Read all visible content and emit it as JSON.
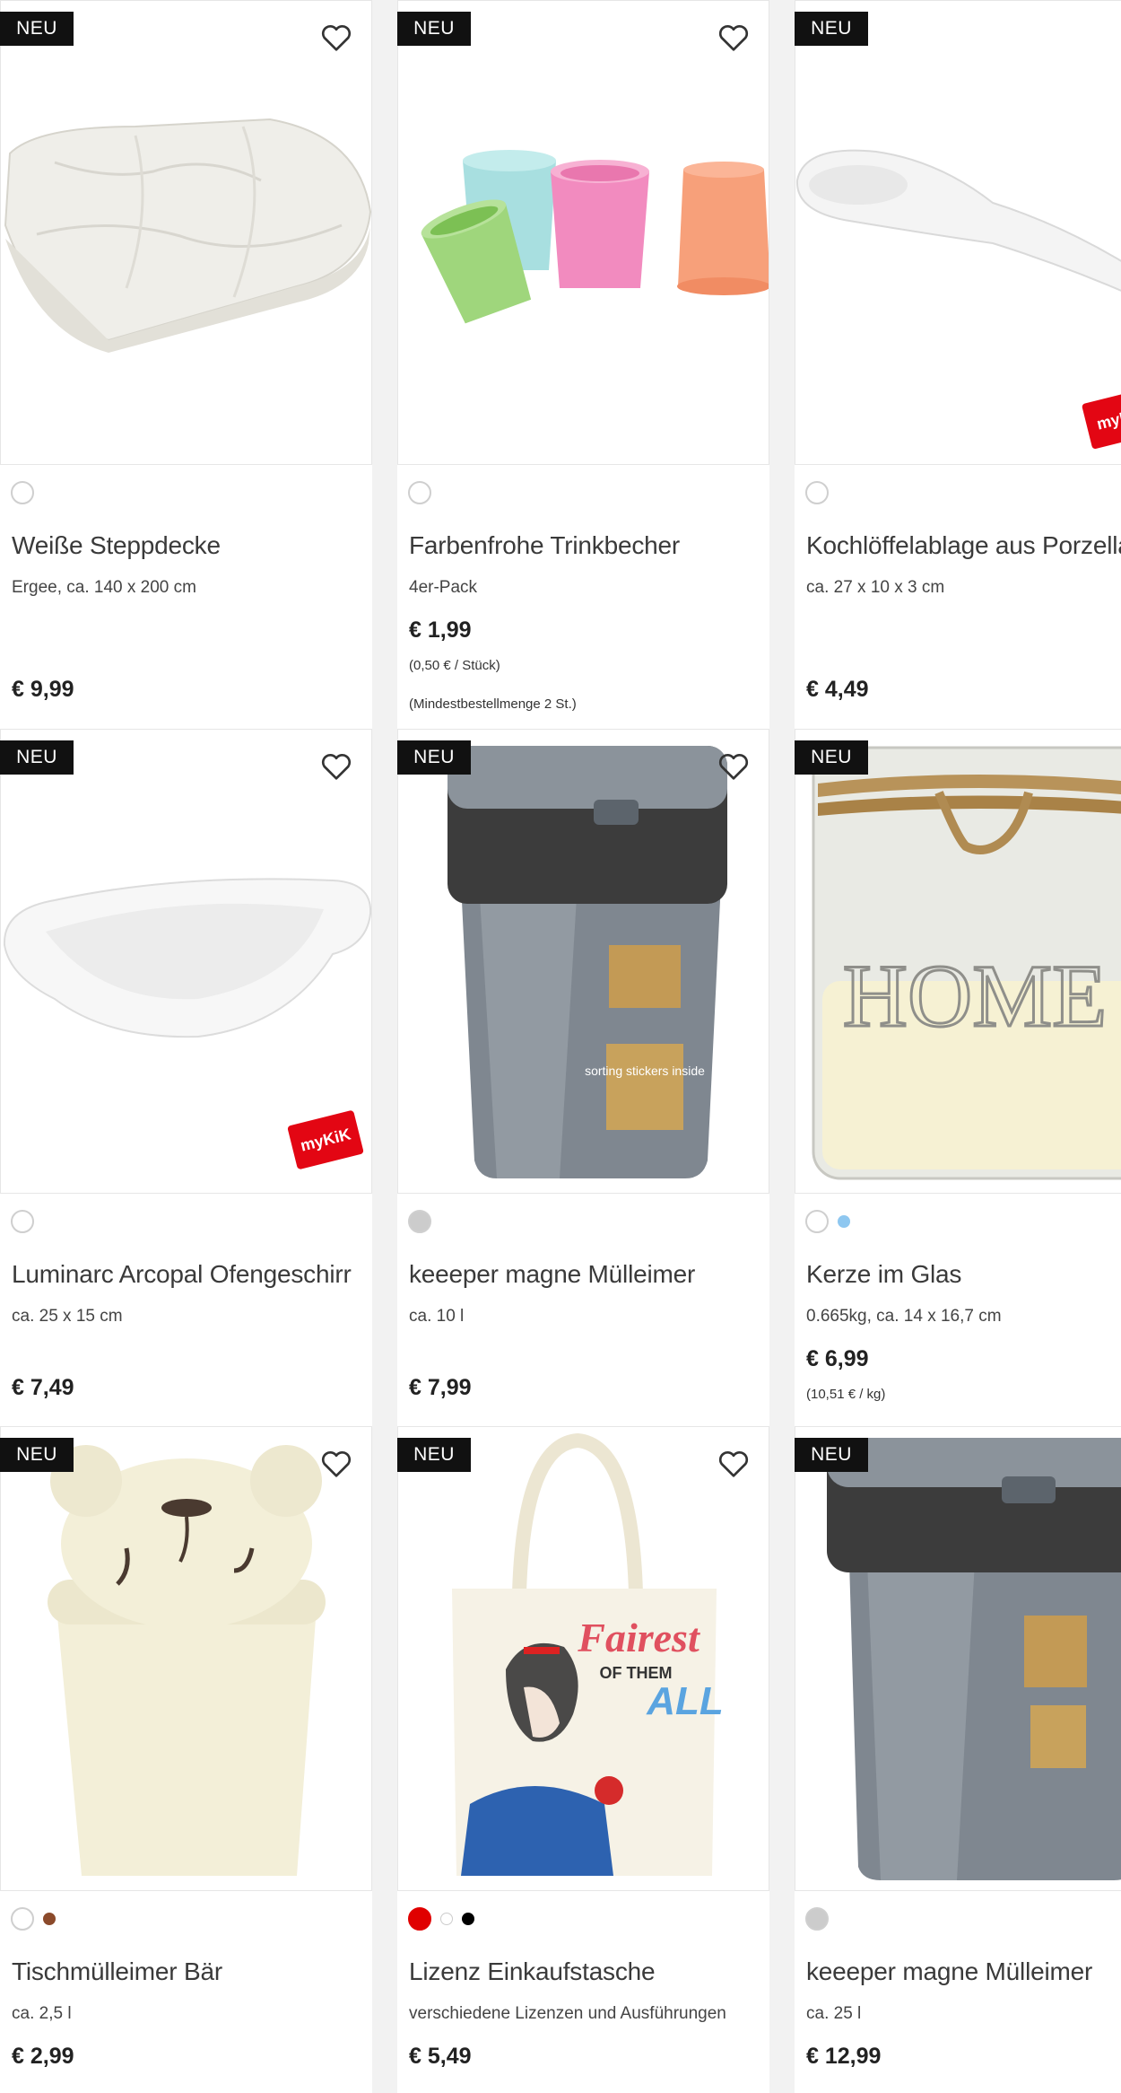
{
  "badge_label": "NEU",
  "accent_colors": {
    "badge_bg": "#111111",
    "mykik_red": "#e30613"
  },
  "products": [
    {
      "title": "Weiße Steppdecke",
      "subtitle": "Ergee, ca. 140 x 200 cm",
      "price": "€ 9,99",
      "unit_price": "",
      "min_order": "",
      "swatches": [
        "#ffffff"
      ]
    },
    {
      "title": "Farbenfrohe Trinkbecher",
      "subtitle": "4er-Pack",
      "price": "€ 1,99",
      "unit_price": "(0,50 € / Stück)",
      "min_order": "(Mindestbestellmenge 2 St.)",
      "swatches": [
        "#ffffff"
      ]
    },
    {
      "title": "Kochlöffelablage aus Porzellan",
      "subtitle": "ca. 27 x 10 x 3 cm",
      "price": "€ 4,49",
      "unit_price": "",
      "min_order": "",
      "swatches": [
        "#ffffff"
      ],
      "mykik_label": "myKiK"
    },
    {
      "title": "Luminarc Arcopal Ofengeschirr",
      "subtitle": "ca. 25 x 15 cm",
      "price": "€ 7,49",
      "unit_price": "",
      "min_order": "",
      "swatches": [
        "#ffffff"
      ],
      "mykik_label": "myKiK"
    },
    {
      "title": "keeeper magne Mülleimer",
      "subtitle": "ca. 10 l",
      "price": "€ 7,99",
      "unit_price": "",
      "min_order": "",
      "swatches": [
        "#cccccc"
      ]
    },
    {
      "title": "Kerze im Glas",
      "subtitle": "0.665kg, ca. 14 x 16,7 cm",
      "price": "€ 6,99",
      "unit_price": "(10,51 € / kg)",
      "min_order": "",
      "swatches": [
        "#ffffff",
        "#8ec7f0"
      ]
    },
    {
      "title": "Tischmülleimer Bär",
      "subtitle": "ca. 2,5 l",
      "price": "€ 2,99",
      "unit_price": "",
      "min_order": "",
      "swatches": [
        "#ffffff",
        "#8b4a2b"
      ]
    },
    {
      "title": "Lizenz Einkaufstasche",
      "subtitle": "verschiedene Lizenzen und Ausführungen",
      "price": "€ 5,49",
      "unit_price": "",
      "min_order": "",
      "swatches": [
        "#e00000",
        "#ffffff",
        "#000000"
      ]
    },
    {
      "title": "keeeper magne Mülleimer",
      "subtitle": "ca. 25 l",
      "price": "€ 12,99",
      "unit_price": "",
      "min_order": "",
      "swatches": [
        "#cccccc"
      ]
    }
  ],
  "image_text": {
    "candle_word": "HOME",
    "tote_line1": "Fairest",
    "tote_line2": "OF THEM",
    "tote_line3": "ALL",
    "bin_label": "sorting stickers inside"
  }
}
